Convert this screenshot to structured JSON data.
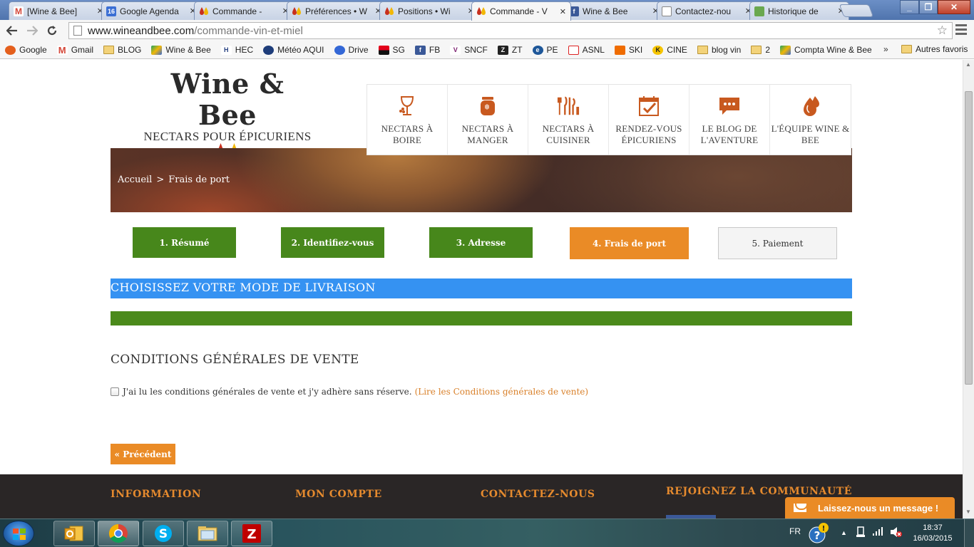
{
  "browser": {
    "tabs": [
      {
        "title": "[Wine & Bee]",
        "icon": "gmail-icon",
        "color": "#d44638"
      },
      {
        "title": "Google Agenda",
        "icon": "calendar-icon",
        "color": "#3b6fd4"
      },
      {
        "title": "Commande -",
        "icon": "wineandbee-icon",
        "color": "#e08a1e"
      },
      {
        "title": "Préférences • W",
        "icon": "wineandbee-icon",
        "color": "#e08a1e"
      },
      {
        "title": "Positions • Wi",
        "icon": "wineandbee-icon",
        "color": "#e08a1e"
      },
      {
        "title": "Commande - V",
        "icon": "wineandbee-icon",
        "color": "#e08a1e",
        "active": true
      },
      {
        "title": "Wine & Bee",
        "icon": "facebook-icon",
        "color": "#3b5998"
      },
      {
        "title": "Contactez-nou",
        "icon": "page-icon",
        "color": "#ffffff"
      },
      {
        "title": "Historique de",
        "icon": "history-icon",
        "color": "#6aa84f"
      }
    ],
    "url_host": "www.wineandbee.com",
    "url_path": "/commande-vin-et-miel",
    "bookmarks": [
      {
        "label": "Google",
        "icon": "google-icon",
        "color": "#e45f1c"
      },
      {
        "label": "Gmail",
        "icon": "gmail-icon",
        "color": "#d44638"
      },
      {
        "label": "BLOG",
        "icon": "folder-icon"
      },
      {
        "label": "Wine & Bee",
        "icon": "drive-icon",
        "color": "#1da462"
      },
      {
        "label": "HEC",
        "icon": "hec-icon",
        "color": "#233e7f"
      },
      {
        "label": "Météo AQUI",
        "icon": "weather-icon",
        "color": "#1e3d7a"
      },
      {
        "label": "Drive",
        "icon": "drive-icon",
        "color": "#3367d6"
      },
      {
        "label": "SG",
        "icon": "sg-icon",
        "color": "#e2001a"
      },
      {
        "label": "FB",
        "icon": "facebook-icon",
        "color": "#3b5998"
      },
      {
        "label": "SNCF",
        "icon": "sncf-icon",
        "color": "#7a1e6e"
      },
      {
        "label": "ZT",
        "icon": "zt-icon",
        "color": "#222222"
      },
      {
        "label": "PE",
        "icon": "pe-icon",
        "color": "#1e5799"
      },
      {
        "label": "ASNL",
        "icon": "asnl-icon",
        "color": "#d22"
      },
      {
        "label": "SKI",
        "icon": "ski-icon",
        "color": "#ef6c00"
      },
      {
        "label": "CINE",
        "icon": "cine-icon",
        "color": "#f5c400"
      },
      {
        "label": "blog vin",
        "icon": "folder-icon"
      },
      {
        "label": "2",
        "icon": "folder-icon"
      },
      {
        "label": "Compta Wine & Bee",
        "icon": "drive-icon",
        "color": "#1da462"
      }
    ],
    "bookmarks_more": "»",
    "other_bookmarks": "Autres favoris"
  },
  "site": {
    "brand": "Wine & Bee",
    "tagline": "NECTARS POUR ÉPICURIENS",
    "nav": [
      {
        "label": "NECTARS À BOIRE",
        "icon": "wine-glass-icon"
      },
      {
        "label": "NECTARS À MANGER",
        "icon": "honey-jar-icon"
      },
      {
        "label": "NECTARS À CUISINER",
        "icon": "utensils-icon"
      },
      {
        "label": "RENDEZ-VOUS ÉPICURIENS",
        "icon": "calendar-check-icon"
      },
      {
        "label": "LE BLOG DE L'AVENTURE",
        "icon": "speech-bubble-icon"
      },
      {
        "label": "L'ÉQUIPE WINE & BEE",
        "icon": "drops-icon"
      }
    ],
    "breadcrumb": {
      "home": "Accueil",
      "sep": ">",
      "current": "Frais de port"
    },
    "steps": [
      {
        "label": "1. Résumé",
        "state": "done"
      },
      {
        "label": "2. Identifiez-vous",
        "state": "done"
      },
      {
        "label": "3. Adresse",
        "state": "done"
      },
      {
        "label": "4. Frais de port",
        "state": "current"
      },
      {
        "label": "5. Paiement",
        "state": "todo"
      }
    ],
    "shipping_title": "CHOISISSEZ VOTRE MODE DE LIVRAISON",
    "terms_title": "CONDITIONS GÉNÉRALES DE VENTE",
    "terms_checkbox_label": "J'ai lu les conditions générales de vente et j'y adhère sans réserve.",
    "terms_checked": false,
    "terms_link": "(Lire les Conditions générales de vente)",
    "prev_button": "« Précédent",
    "footer": [
      "INFORMATION",
      "MON COMPTE",
      "CONTACTEZ-NOUS",
      "REJOIGNEZ LA COMMUNAUTÉ"
    ],
    "chat_button": "Laissez-nous un message !",
    "colors": {
      "accent": "#ea8b26",
      "step_done": "#47871b",
      "title_bar": "#3592f2"
    }
  },
  "taskbar": {
    "language": "FR",
    "time": "18:37",
    "date": "16/03/2015",
    "apps": [
      "outlook-icon",
      "chrome-icon",
      "skype-icon",
      "explorer-icon",
      "filezilla-icon"
    ]
  }
}
